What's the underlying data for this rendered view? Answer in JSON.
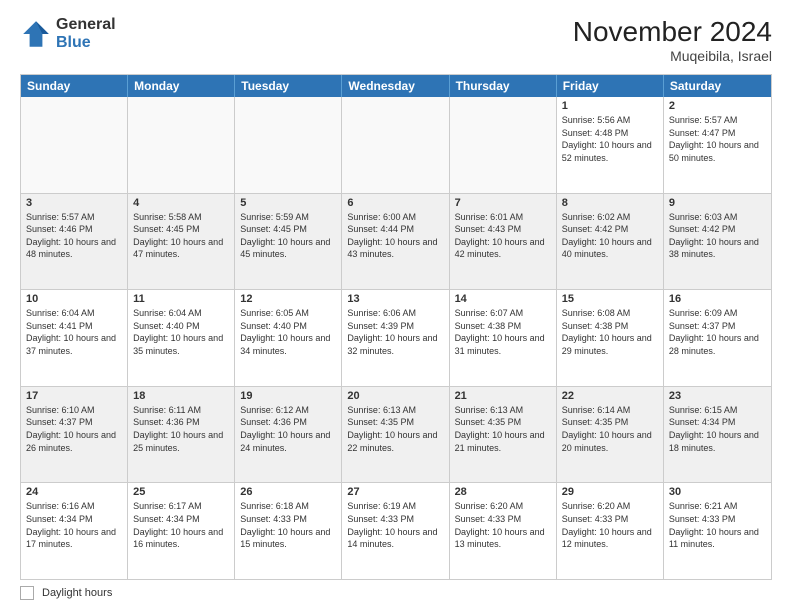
{
  "logo": {
    "general": "General",
    "blue": "Blue"
  },
  "header": {
    "title": "November 2024",
    "subtitle": "Muqeibila, Israel"
  },
  "days_of_week": [
    "Sunday",
    "Monday",
    "Tuesday",
    "Wednesday",
    "Thursday",
    "Friday",
    "Saturday"
  ],
  "weeks": [
    [
      {
        "day": "",
        "info": "",
        "empty": true
      },
      {
        "day": "",
        "info": "",
        "empty": true
      },
      {
        "day": "",
        "info": "",
        "empty": true
      },
      {
        "day": "",
        "info": "",
        "empty": true
      },
      {
        "day": "",
        "info": "",
        "empty": true
      },
      {
        "day": "1",
        "info": "Sunrise: 5:56 AM\nSunset: 4:48 PM\nDaylight: 10 hours and 52 minutes."
      },
      {
        "day": "2",
        "info": "Sunrise: 5:57 AM\nSunset: 4:47 PM\nDaylight: 10 hours and 50 minutes."
      }
    ],
    [
      {
        "day": "3",
        "info": "Sunrise: 5:57 AM\nSunset: 4:46 PM\nDaylight: 10 hours and 48 minutes."
      },
      {
        "day": "4",
        "info": "Sunrise: 5:58 AM\nSunset: 4:45 PM\nDaylight: 10 hours and 47 minutes."
      },
      {
        "day": "5",
        "info": "Sunrise: 5:59 AM\nSunset: 4:45 PM\nDaylight: 10 hours and 45 minutes."
      },
      {
        "day": "6",
        "info": "Sunrise: 6:00 AM\nSunset: 4:44 PM\nDaylight: 10 hours and 43 minutes."
      },
      {
        "day": "7",
        "info": "Sunrise: 6:01 AM\nSunset: 4:43 PM\nDaylight: 10 hours and 42 minutes."
      },
      {
        "day": "8",
        "info": "Sunrise: 6:02 AM\nSunset: 4:42 PM\nDaylight: 10 hours and 40 minutes."
      },
      {
        "day": "9",
        "info": "Sunrise: 6:03 AM\nSunset: 4:42 PM\nDaylight: 10 hours and 38 minutes."
      }
    ],
    [
      {
        "day": "10",
        "info": "Sunrise: 6:04 AM\nSunset: 4:41 PM\nDaylight: 10 hours and 37 minutes."
      },
      {
        "day": "11",
        "info": "Sunrise: 6:04 AM\nSunset: 4:40 PM\nDaylight: 10 hours and 35 minutes."
      },
      {
        "day": "12",
        "info": "Sunrise: 6:05 AM\nSunset: 4:40 PM\nDaylight: 10 hours and 34 minutes."
      },
      {
        "day": "13",
        "info": "Sunrise: 6:06 AM\nSunset: 4:39 PM\nDaylight: 10 hours and 32 minutes."
      },
      {
        "day": "14",
        "info": "Sunrise: 6:07 AM\nSunset: 4:38 PM\nDaylight: 10 hours and 31 minutes."
      },
      {
        "day": "15",
        "info": "Sunrise: 6:08 AM\nSunset: 4:38 PM\nDaylight: 10 hours and 29 minutes."
      },
      {
        "day": "16",
        "info": "Sunrise: 6:09 AM\nSunset: 4:37 PM\nDaylight: 10 hours and 28 minutes."
      }
    ],
    [
      {
        "day": "17",
        "info": "Sunrise: 6:10 AM\nSunset: 4:37 PM\nDaylight: 10 hours and 26 minutes."
      },
      {
        "day": "18",
        "info": "Sunrise: 6:11 AM\nSunset: 4:36 PM\nDaylight: 10 hours and 25 minutes."
      },
      {
        "day": "19",
        "info": "Sunrise: 6:12 AM\nSunset: 4:36 PM\nDaylight: 10 hours and 24 minutes."
      },
      {
        "day": "20",
        "info": "Sunrise: 6:13 AM\nSunset: 4:35 PM\nDaylight: 10 hours and 22 minutes."
      },
      {
        "day": "21",
        "info": "Sunrise: 6:13 AM\nSunset: 4:35 PM\nDaylight: 10 hours and 21 minutes."
      },
      {
        "day": "22",
        "info": "Sunrise: 6:14 AM\nSunset: 4:35 PM\nDaylight: 10 hours and 20 minutes."
      },
      {
        "day": "23",
        "info": "Sunrise: 6:15 AM\nSunset: 4:34 PM\nDaylight: 10 hours and 18 minutes."
      }
    ],
    [
      {
        "day": "24",
        "info": "Sunrise: 6:16 AM\nSunset: 4:34 PM\nDaylight: 10 hours and 17 minutes."
      },
      {
        "day": "25",
        "info": "Sunrise: 6:17 AM\nSunset: 4:34 PM\nDaylight: 10 hours and 16 minutes."
      },
      {
        "day": "26",
        "info": "Sunrise: 6:18 AM\nSunset: 4:33 PM\nDaylight: 10 hours and 15 minutes."
      },
      {
        "day": "27",
        "info": "Sunrise: 6:19 AM\nSunset: 4:33 PM\nDaylight: 10 hours and 14 minutes."
      },
      {
        "day": "28",
        "info": "Sunrise: 6:20 AM\nSunset: 4:33 PM\nDaylight: 10 hours and 13 minutes."
      },
      {
        "day": "29",
        "info": "Sunrise: 6:20 AM\nSunset: 4:33 PM\nDaylight: 10 hours and 12 minutes."
      },
      {
        "day": "30",
        "info": "Sunrise: 6:21 AM\nSunset: 4:33 PM\nDaylight: 10 hours and 11 minutes."
      }
    ]
  ],
  "footer": {
    "legend_label": "Daylight hours"
  }
}
